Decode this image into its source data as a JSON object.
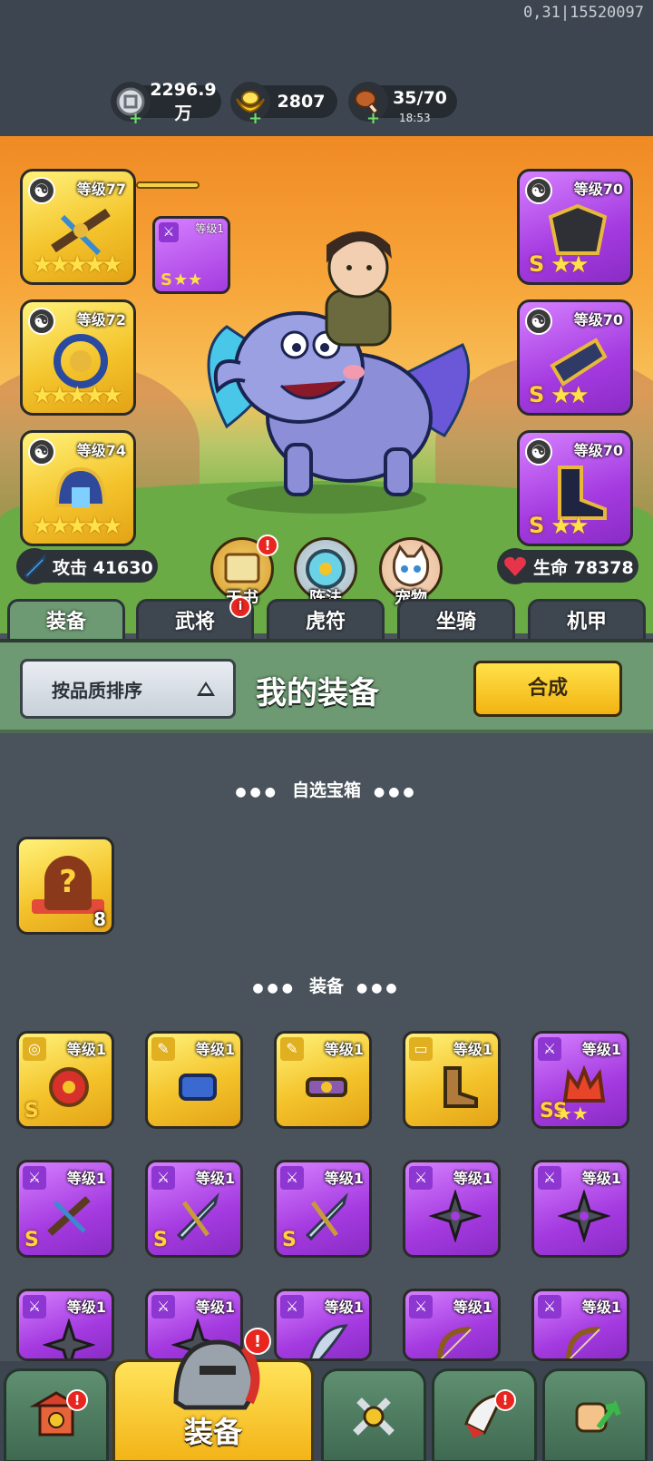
{
  "version": "0,31|15520097",
  "resources": {
    "silver": {
      "value": "2296.9万",
      "icon": "silver-coin-icon"
    },
    "gold": {
      "value": "2807",
      "icon": "gold-ingot-icon"
    },
    "stamina": {
      "value": "35/70",
      "timer": "18:53",
      "icon": "meat-drumstick-icon"
    }
  },
  "equipped": {
    "left": [
      {
        "level": "等级77",
        "stars": "★★★★★",
        "color": "gold"
      },
      {
        "level": "等级72",
        "stars": "★★★★★",
        "color": "gold"
      },
      {
        "level": "等级74",
        "stars": "★★★★★",
        "color": "gold"
      }
    ],
    "right": [
      {
        "level": "等级70",
        "grade": "S",
        "stars": "★★",
        "color": "purple"
      },
      {
        "level": "等级70",
        "grade": "S",
        "stars": "★★",
        "color": "purple"
      },
      {
        "level": "等级70",
        "grade": "S",
        "stars": "★★",
        "color": "purple"
      }
    ],
    "linked": {
      "level": "等级1",
      "grade": "S",
      "stars": "★★"
    }
  },
  "stats": {
    "attack": "攻击 41630",
    "hp": "生命 78378"
  },
  "features": [
    {
      "label": "天书",
      "badge": "!"
    },
    {
      "label": "阵法",
      "badge": ""
    },
    {
      "label": "宠物",
      "badge": ""
    }
  ],
  "tabs": [
    {
      "label": "装备",
      "badge": ""
    },
    {
      "label": "武将",
      "badge": "i"
    },
    {
      "label": "虎符",
      "badge": ""
    },
    {
      "label": "坐骑",
      "badge": ""
    },
    {
      "label": "机甲",
      "badge": ""
    }
  ],
  "panel": {
    "sort_label": "按品质排序",
    "title": "我的装备",
    "synth_label": "合成"
  },
  "sections": {
    "chest_title": "自选宝箱",
    "equip_title": "装备"
  },
  "chest": {
    "count": "8"
  },
  "items": [
    {
      "level": "等级1",
      "grade": "S",
      "stars": "",
      "color": "gold"
    },
    {
      "level": "等级1",
      "grade": "",
      "stars": "",
      "color": "gold"
    },
    {
      "level": "等级1",
      "grade": "",
      "stars": "",
      "color": "gold"
    },
    {
      "level": "等级1",
      "grade": "",
      "stars": "",
      "color": "gold"
    },
    {
      "level": "等级1",
      "grade": "SS",
      "stars": "★★",
      "color": "purple"
    },
    {
      "level": "等级1",
      "grade": "S",
      "stars": "",
      "color": "purple"
    },
    {
      "level": "等级1",
      "grade": "S",
      "stars": "",
      "color": "purple"
    },
    {
      "level": "等级1",
      "grade": "S",
      "stars": "",
      "color": "purple"
    },
    {
      "level": "等级1",
      "grade": "",
      "stars": "",
      "color": "purple"
    },
    {
      "level": "等级1",
      "grade": "",
      "stars": "",
      "color": "purple"
    },
    {
      "level": "等级1",
      "grade": "",
      "stars": "",
      "color": "purple"
    },
    {
      "level": "等级1",
      "grade": "",
      "stars": "",
      "color": "purple"
    },
    {
      "level": "等级1",
      "grade": "",
      "stars": "",
      "color": "purple"
    },
    {
      "level": "等级1",
      "grade": "",
      "stars": "",
      "color": "purple"
    },
    {
      "level": "等级1",
      "grade": "",
      "stars": "",
      "color": "purple"
    }
  ],
  "bottom_nav": [
    {
      "label": "",
      "icon": "shop-gate-icon",
      "badge": "!"
    },
    {
      "label": "装备",
      "icon": "helmet-icon",
      "badge": "!"
    },
    {
      "label": "",
      "icon": "crossed-swords-icon",
      "badge": ""
    },
    {
      "label": "",
      "icon": "horn-icon",
      "badge": "!"
    },
    {
      "label": "",
      "icon": "fist-upgrade-icon",
      "badge": ""
    }
  ]
}
